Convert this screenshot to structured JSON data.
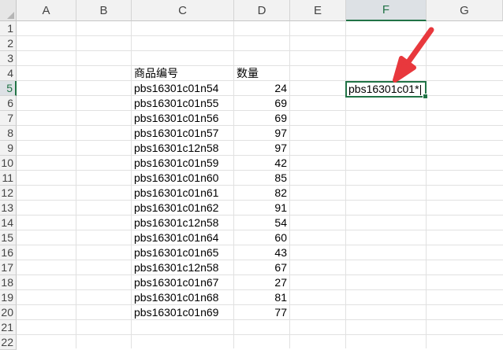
{
  "columns": [
    "A",
    "B",
    "C",
    "D",
    "E",
    "F",
    "G"
  ],
  "rows": [
    "1",
    "2",
    "3",
    "4",
    "5",
    "6",
    "7",
    "8",
    "9",
    "10",
    "11",
    "12",
    "13",
    "14",
    "15",
    "16",
    "17",
    "18",
    "19",
    "20",
    "21",
    "22"
  ],
  "table": {
    "header_code": "商品编号",
    "header_qty": "数量",
    "items": [
      {
        "code": "pbs16301c01n54",
        "qty": "24"
      },
      {
        "code": "pbs16301c01n55",
        "qty": "69"
      },
      {
        "code": "pbs16301c01n56",
        "qty": "69"
      },
      {
        "code": "pbs16301c01n57",
        "qty": "97"
      },
      {
        "code": "pbs16301c12n58",
        "qty": "97"
      },
      {
        "code": "pbs16301c01n59",
        "qty": "42"
      },
      {
        "code": "pbs16301c01n60",
        "qty": "85"
      },
      {
        "code": "pbs16301c01n61",
        "qty": "82"
      },
      {
        "code": "pbs16301c01n62",
        "qty": "91"
      },
      {
        "code": "pbs16301c12n58",
        "qty": "54"
      },
      {
        "code": "pbs16301c01n64",
        "qty": "60"
      },
      {
        "code": "pbs16301c01n65",
        "qty": "43"
      },
      {
        "code": "pbs16301c12n58",
        "qty": "67"
      },
      {
        "code": "pbs16301c01n67",
        "qty": "27"
      },
      {
        "code": "pbs16301c01n68",
        "qty": "81"
      },
      {
        "code": "pbs16301c01n69",
        "qty": "77"
      }
    ]
  },
  "active_cell": {
    "value": "pbs16301c01*",
    "selected_column": "F",
    "selected_row": "5"
  },
  "colors": {
    "selection_green": "#217346",
    "annotation_arrow": "#e8383d"
  }
}
